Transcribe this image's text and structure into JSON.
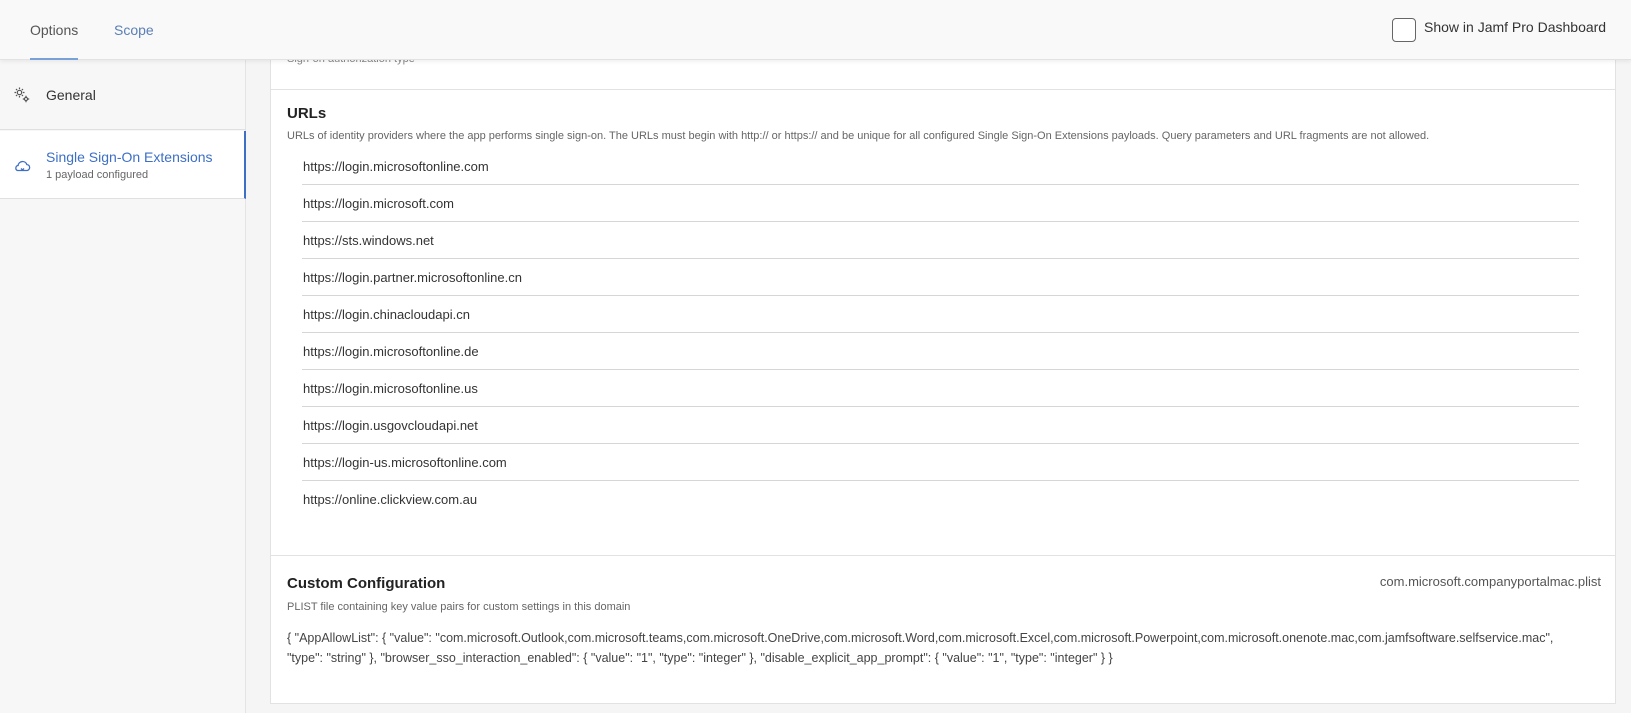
{
  "tabs": {
    "options": "Options",
    "scope": "Scope"
  },
  "dashboard": {
    "label": "Show in Jamf Pro Dashboard",
    "checked": false
  },
  "sidebar": {
    "items": [
      {
        "label": "General",
        "icon": "gears-icon"
      },
      {
        "label": "Single Sign-On Extensions",
        "sub": "1 payload configured",
        "icon": "cloud-icon"
      }
    ]
  },
  "main": {
    "cut_label": "Sign-on authorization type",
    "urls": {
      "title": "URLs",
      "description": "URLs of identity providers where the app performs single sign-on. The URLs must begin with http:// or https:// and be unique for all configured Single Sign-On Extensions payloads. Query parameters and URL fragments are not allowed.",
      "items": [
        "https://login.microsoftonline.com",
        "https://login.microsoft.com",
        "https://sts.windows.net",
        "https://login.partner.microsoftonline.cn",
        "https://login.chinacloudapi.cn",
        "https://login.microsoftonline.de",
        "https://login.microsoftonline.us",
        "https://login.usgovcloudapi.net",
        "https://login-us.microsoftonline.com",
        "https://online.clickview.com.au"
      ]
    },
    "custom": {
      "title": "Custom Configuration",
      "description": "PLIST file containing key value pairs for custom settings in this domain",
      "domain": "com.microsoft.companyportalmac.plist",
      "plist": "{ \"AppAllowList\": { \"value\": \"com.microsoft.Outlook,com.microsoft.teams,com.microsoft.OneDrive,com.microsoft.Word,com.microsoft.Excel,com.microsoft.Powerpoint,com.microsoft.onenote.mac,com.jamfsoftware.selfservice.mac\", \"type\": \"string\" }, \"browser_sso_interaction_enabled\": { \"value\": \"1\", \"type\": \"integer\" }, \"disable_explicit_app_prompt\": { \"value\": \"1\", \"type\": \"integer\" } }"
    }
  }
}
